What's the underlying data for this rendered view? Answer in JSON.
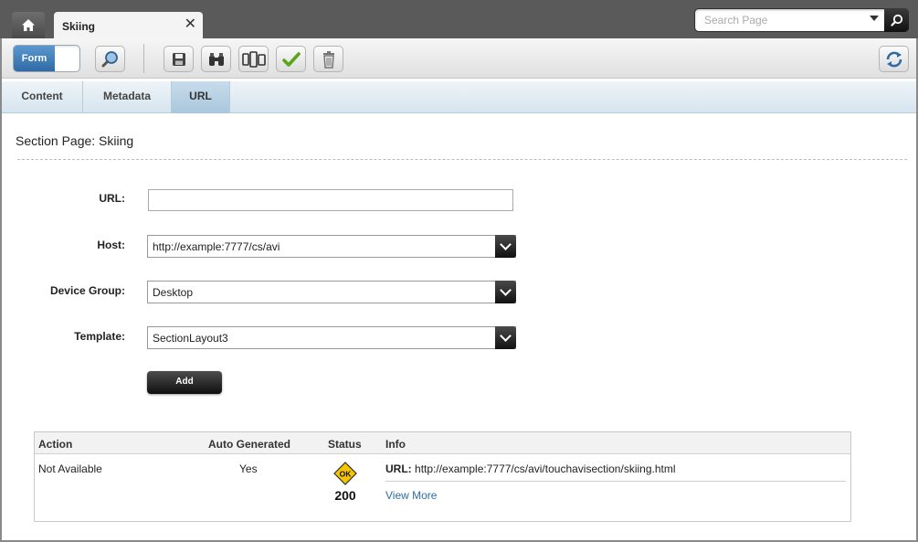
{
  "tabs": {
    "page_tab": "Skiing"
  },
  "search": {
    "placeholder": "Search Page"
  },
  "toolbar": {
    "mode_toggle": "Form"
  },
  "subtabs": [
    "Content",
    "Metadata",
    "URL"
  ],
  "page": {
    "title": "Section Page: Skiing"
  },
  "form": {
    "url_label": "URL:",
    "url_value": "",
    "host_label": "Host:",
    "host_value": "http://example:7777/cs/avi",
    "device_group_label": "Device Group:",
    "device_group_value": "Desktop",
    "template_label": "Template:",
    "template_value": "SectionLayout3",
    "add_button": "Add"
  },
  "table": {
    "headers": [
      "Action",
      "Auto Generated",
      "Status",
      "Info"
    ],
    "rows": [
      {
        "action": "Not Available",
        "auto_generated": "Yes",
        "status_badge": "OK",
        "status_code": "200",
        "info_label": "URL:",
        "info_url": "http://example:7777/cs/avi/touchavisection/skiing.html",
        "view_more": "View More"
      }
    ]
  },
  "colors": {
    "accent": "#2f6aa6",
    "active_tab": "#a9c7dc",
    "ok_badge": "#f6c500"
  }
}
